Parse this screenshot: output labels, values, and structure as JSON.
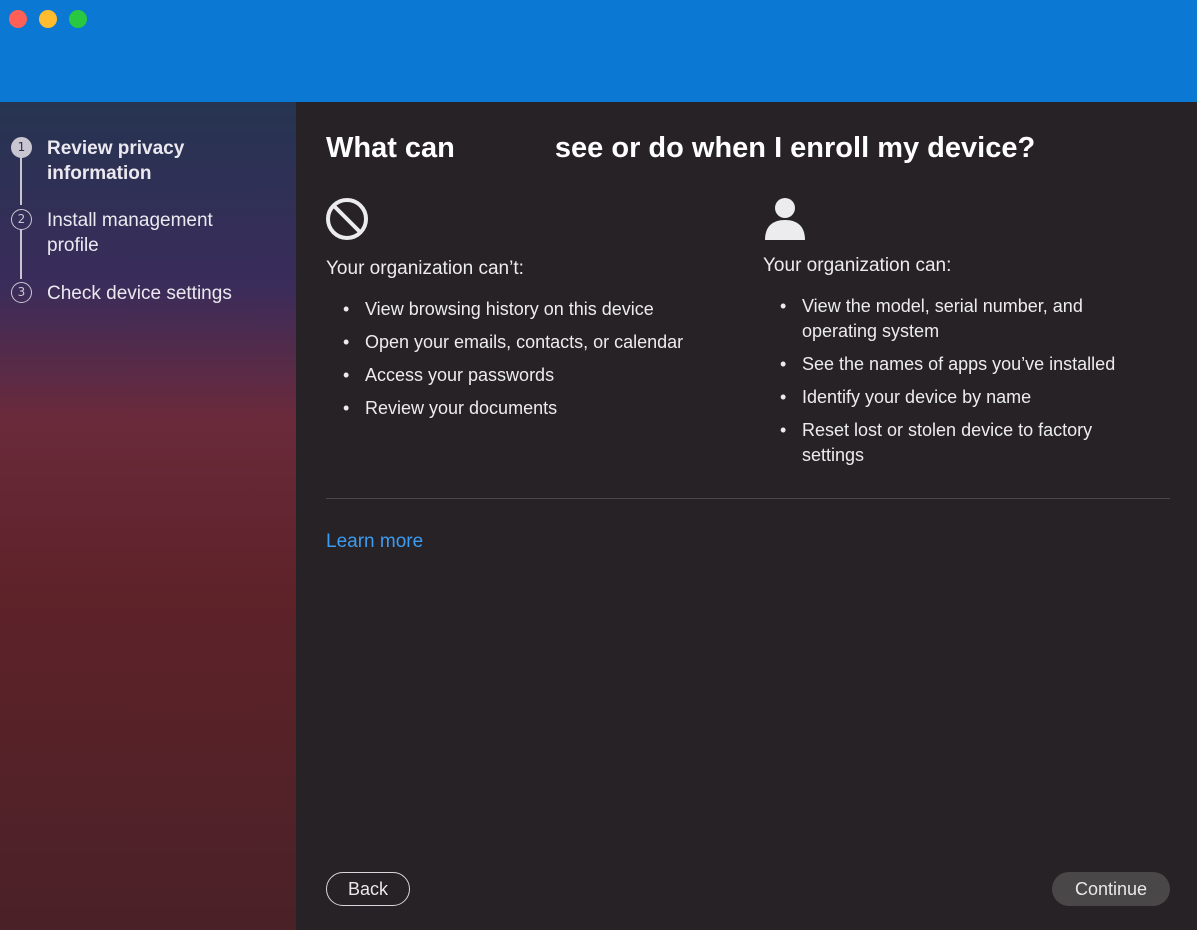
{
  "window": {
    "traffic_lights": {
      "close": "#fe5f57",
      "minimize": "#febc2e",
      "maximize": "#28c840"
    },
    "header_color": "#0b78d3"
  },
  "sidebar": {
    "steps": [
      {
        "number": "1",
        "label": "Review privacy information",
        "active": true
      },
      {
        "number": "2",
        "label": "Install management profile",
        "active": false
      },
      {
        "number": "3",
        "label": "Check device settings",
        "active": false
      }
    ]
  },
  "main": {
    "title_part1": "What can",
    "title_part2": "see or do when I enroll my device?",
    "cannot": {
      "icon": "prohibited-icon",
      "heading": "Your organization can’t:",
      "items": [
        "View browsing history on this device",
        "Open your emails, contacts, or calendar",
        "Access your passwords",
        "Review your documents"
      ]
    },
    "can": {
      "icon": "person-icon",
      "heading": "Your organization can:",
      "items": [
        "View the model, serial number, and operating system",
        "See the names of apps you’ve installed",
        "Identify your device by name",
        "Reset lost or stolen device to factory settings"
      ]
    },
    "learn_more": "Learn more",
    "bullet": "•"
  },
  "buttons": {
    "back": "Back",
    "continue": "Continue"
  }
}
